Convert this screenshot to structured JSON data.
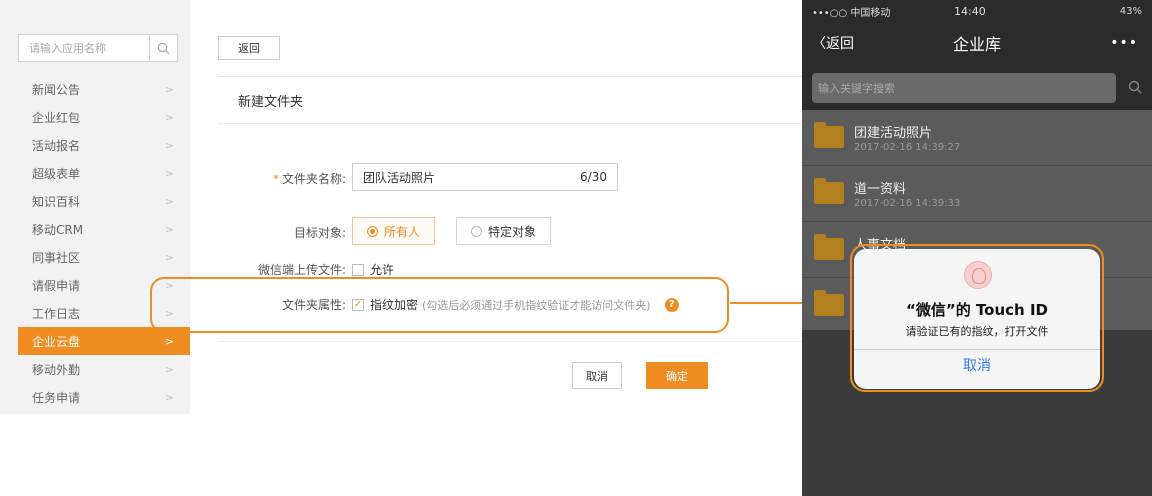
{
  "colors": {
    "accent": "#ef8c22",
    "ios_blue": "#3478f6"
  },
  "sidebar": {
    "search_placeholder": "请输入应用名称",
    "items": [
      {
        "label": "新闻公告",
        "active": false
      },
      {
        "label": "企业红包",
        "active": false
      },
      {
        "label": "活动报名",
        "active": false
      },
      {
        "label": "超级表单",
        "active": false
      },
      {
        "label": "知识百科",
        "active": false
      },
      {
        "label": "移动CRM",
        "active": false
      },
      {
        "label": "同事社区",
        "active": false
      },
      {
        "label": "请假申请",
        "active": false
      },
      {
        "label": "工作日志",
        "active": false
      },
      {
        "label": "企业云盘",
        "active": true
      },
      {
        "label": "移动外勤",
        "active": false
      },
      {
        "label": "任务申请",
        "active": false
      }
    ]
  },
  "main": {
    "back_label": "返回",
    "panel_title": "新建文件夹",
    "form": {
      "name_label": "文件夹名称:",
      "name_value": "团队活动照片",
      "name_count": "6/30",
      "target_label": "目标对象:",
      "target_options": [
        "所有人",
        "特定对象"
      ],
      "target_selected": "所有人",
      "upload_label": "微信端上传文件:",
      "upload_option": "允许",
      "attr_label": "文件夹属性:",
      "attr_option": "指纹加密",
      "attr_hint": "(勾选后必须通过手机指纹验证才能访问文件夹)"
    },
    "cancel_label": "取消",
    "ok_label": "确定"
  },
  "phone": {
    "status": {
      "carrier": "•••○○ 中国移动",
      "time": "14:40",
      "battery": "43%"
    },
    "nav": {
      "back": "〈返回",
      "title": "企业库",
      "more": "•••"
    },
    "search_placeholder": "输入关键字搜索",
    "files": [
      {
        "name": "团建活动照片",
        "date": "2017-02-16 14:39:27"
      },
      {
        "name": "道一资料",
        "date": "2017-02-16 14:39:33"
      },
      {
        "name": "人事文档",
        "date": ""
      }
    ],
    "dialog": {
      "title": "“微信”的 Touch ID",
      "message": "请验证已有的指纹，打开文件",
      "cancel": "取消"
    }
  }
}
